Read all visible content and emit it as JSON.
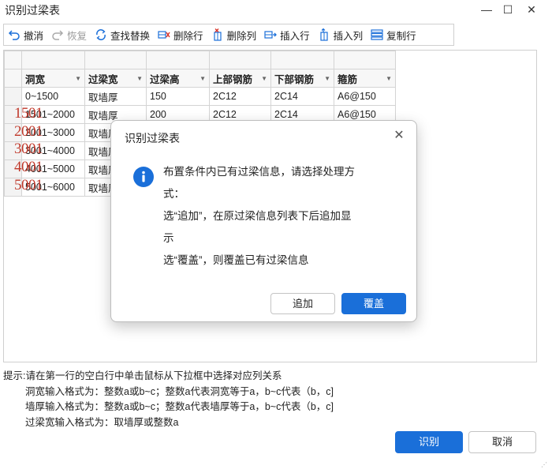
{
  "window": {
    "title": "识别过梁表",
    "minimize": "—",
    "maximize": "☐",
    "close": "✕"
  },
  "toolbar": {
    "items": [
      {
        "label": "撤消",
        "icon": "undo-icon",
        "enabled": true
      },
      {
        "label": "恢复",
        "icon": "redo-icon",
        "enabled": false
      },
      {
        "label": "查找替换",
        "icon": "find-replace-icon",
        "enabled": true
      },
      {
        "label": "删除行",
        "icon": "delete-row-icon",
        "enabled": true
      },
      {
        "label": "删除列",
        "icon": "delete-column-icon",
        "enabled": true
      },
      {
        "label": "插入行",
        "icon": "insert-row-icon",
        "enabled": true
      },
      {
        "label": "插入列",
        "icon": "insert-column-icon",
        "enabled": true
      },
      {
        "label": "复制行",
        "icon": "copy-row-icon",
        "enabled": true
      }
    ]
  },
  "grid": {
    "headers": [
      "洞宽",
      "过梁宽",
      "过梁高",
      "上部钢筋",
      "下部钢筋",
      "箍筋"
    ],
    "rows": [
      [
        "0~1500",
        "取墙厚",
        "150",
        "2C12",
        "2C14",
        "A6@150"
      ],
      [
        "1501~2000",
        "取墙厚",
        "200",
        "2C12",
        "2C14",
        "A6@150"
      ],
      [
        "2001~3000",
        "取墙厚",
        "",
        "",
        "",
        ""
      ],
      [
        "3001~4000",
        "取墙厚",
        "",
        "",
        "",
        ""
      ],
      [
        "4001~5000",
        "取墙厚",
        "",
        "",
        "",
        ""
      ],
      [
        "5001~6000",
        "取墙厚",
        "",
        "",
        "",
        ""
      ]
    ]
  },
  "overlay_numbers": [
    "1501",
    "2001",
    "3001",
    "4001",
    "5001"
  ],
  "dialog": {
    "title": "识别过梁表",
    "close": "✕",
    "message_lines": [
      "布置条件内已有过梁信息，请选择处理方",
      "式：",
      "选“追加”，在原过梁信息列表下后追加显",
      "示",
      "选“覆盖”，则覆盖已有过梁信息"
    ],
    "append_label": "追加",
    "overwrite_label": "覆盖"
  },
  "hints": {
    "main": "提示:请在第一行的空白行中单击鼠标从下拉框中选择对应列关系",
    "lines": [
      "洞宽输入格式为：整数a或b~c；整数a代表洞宽等于a，b~c代表（b，c]",
      "墙厚输入格式为：整数a或b~c；整数a代表墙厚等于a，b~c代表（b，c]",
      "过梁宽输入格式为：取墙厚或整数a"
    ]
  },
  "footer": {
    "ok_label": "识别",
    "cancel_label": "取消"
  },
  "colors": {
    "accent": "#1a6fd9",
    "overlay_red": "#c0392b"
  }
}
